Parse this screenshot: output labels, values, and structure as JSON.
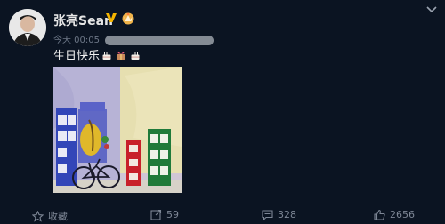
{
  "post": {
    "username": "张亮Sean",
    "time": "今天 00:05",
    "text": "生日快乐"
  },
  "footer": {
    "favorite_label": "收藏",
    "repost_count": "59",
    "comment_count": "328",
    "like_count": "2656"
  },
  "icons": {
    "verified": "verified-v-icon",
    "member": "crown-icon",
    "menu": "chevron-down-icon",
    "cake": "birthday-cake-icon",
    "gift": "gift-icon",
    "favorite": "star-icon",
    "repost": "repost-icon",
    "comment": "comment-icon",
    "like": "thumbs-up-icon"
  },
  "colors": {
    "background": "#0b1422",
    "verified": "#f5b500",
    "footer_text": "#7d8695"
  }
}
